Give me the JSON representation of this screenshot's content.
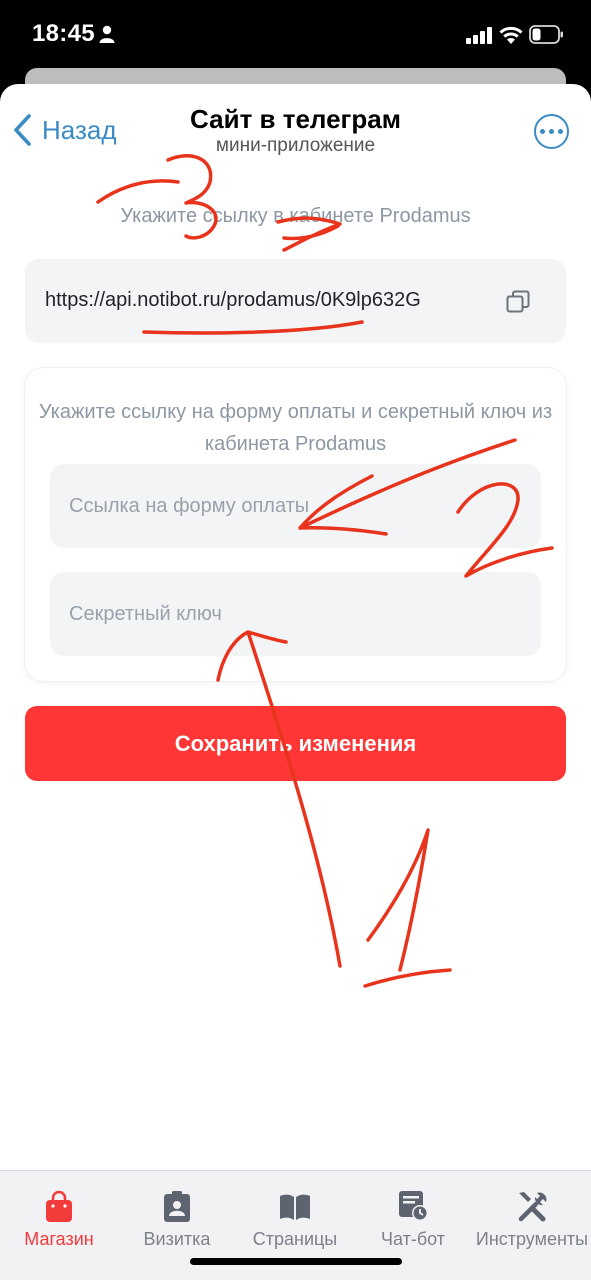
{
  "status_bar": {
    "time": "18:45"
  },
  "header": {
    "back_label": "Назад",
    "title": "Сайт в телеграм",
    "subtitle": "мини-приложение"
  },
  "link_section": {
    "hint": "Укажите ссылку в кабинете Prodamus",
    "url": "https://api.notibot.ru/prodamus/0K9lp632G"
  },
  "form": {
    "hint": "Укажите ссылку на форму оплаты и секретный ключ из кабинета Prodamus",
    "payment_link_placeholder": "Ссылка на форму оплаты",
    "secret_key_placeholder": "Секретный ключ"
  },
  "save_button_label": "Сохранить изменения",
  "annotations": [
    "3",
    "2",
    "1"
  ],
  "tabs": [
    {
      "label": "Магазин",
      "icon": "shopping-bag-icon",
      "active": true
    },
    {
      "label": "Визитка",
      "icon": "badge-icon",
      "active": false
    },
    {
      "label": "Страницы",
      "icon": "book-icon",
      "active": false
    },
    {
      "label": "Чат-бот",
      "icon": "chat-clock-icon",
      "active": false
    },
    {
      "label": "Инструменты",
      "icon": "tools-icon",
      "active": false
    }
  ],
  "colors": {
    "accent_blue": "#3a8bc4",
    "save_red": "#ff3636",
    "active_tab_red": "#f23b3b",
    "annotation_red": "#e8341c"
  }
}
